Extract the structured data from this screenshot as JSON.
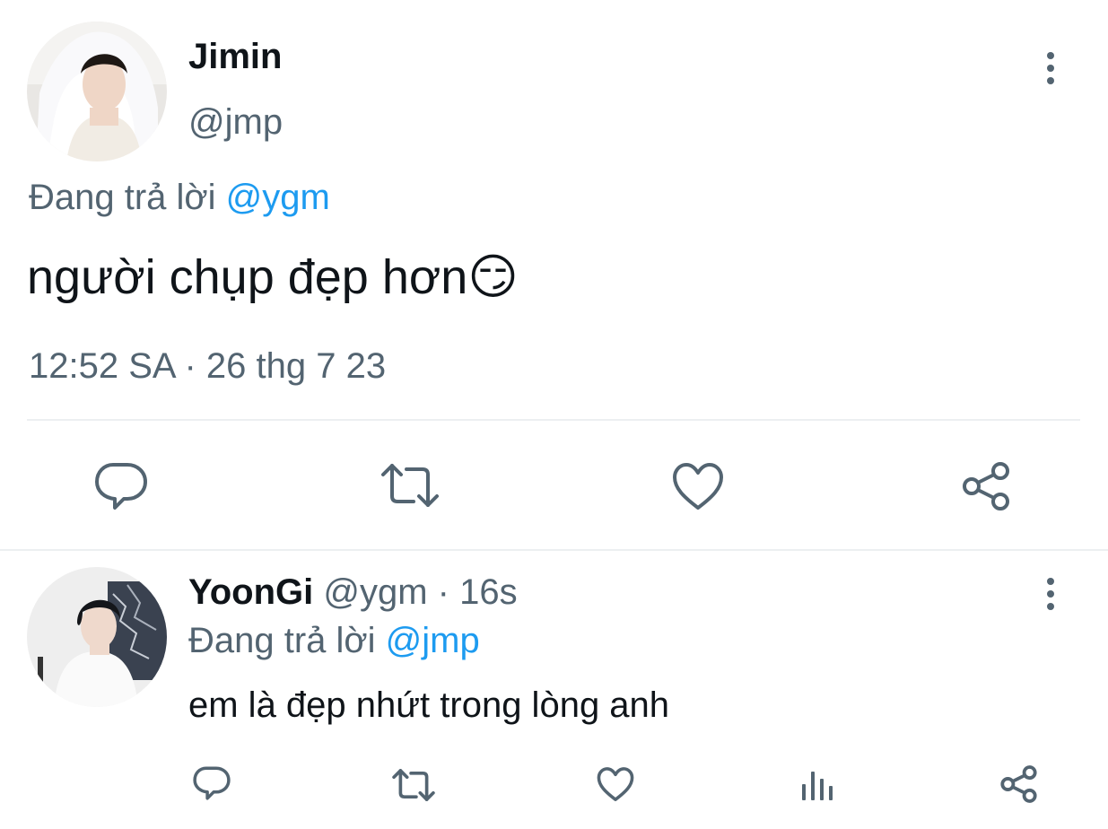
{
  "main_tweet": {
    "author_name": "Jimin",
    "handle": "@jmp",
    "replying_prefix": "Đang trả lời",
    "replying_to": "@ygm",
    "text": "người chụp đẹp hơn",
    "emoji": "😏",
    "timestamp": "12:52 SA · 26 thg 7 23",
    "actions": [
      "reply-icon",
      "retweet-icon",
      "like-icon",
      "share-icon"
    ]
  },
  "reply_tweet": {
    "author_name": "YoonGi",
    "handle": "@ygm",
    "time_ago": "· 16s",
    "replying_prefix": "Đang trả lời",
    "replying_to": "@jmp",
    "text": "em là đẹp nhứt trong lòng anh",
    "actions": [
      "reply-icon",
      "retweet-icon",
      "like-icon",
      "analytics-icon",
      "share-icon"
    ]
  },
  "colors": {
    "text": "#0f1419",
    "muted": "#536471",
    "link": "#1d9bf0",
    "divider": "#eceff1"
  }
}
